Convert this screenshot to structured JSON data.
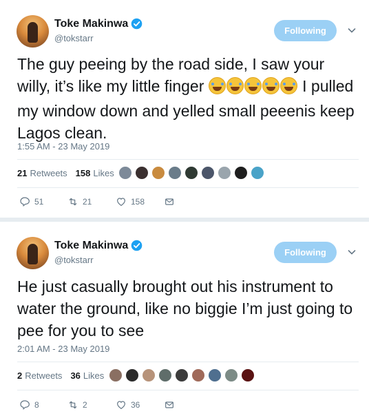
{
  "tweets": [
    {
      "user": {
        "name": "Toke Makinwa",
        "handle": "@tokstarr",
        "verified": true
      },
      "follow_label": "Following",
      "text_before": "The guy peeing by the road side, I saw your willy, it’s like my little finger",
      "emoji": "rolling-on-floor-laughing",
      "emoji_count": 5,
      "text_after": "I pulled my window down and yelled small peeenis keep Lagos clean.",
      "timestamp": "1:55 AM - 23 May 2019",
      "retweets_count": "21",
      "retweets_label": "Retweets",
      "likes_count": "158",
      "likes_label": "Likes",
      "actions": {
        "reply": "51",
        "retweet": "21",
        "like": "158"
      }
    },
    {
      "user": {
        "name": "Toke Makinwa",
        "handle": "@tokstarr",
        "verified": true
      },
      "follow_label": "Following",
      "text": "He just casually brought out his instrument to water the ground, like no biggie I’m just going to pee for you to see",
      "timestamp": "2:01 AM - 23 May 2019",
      "retweets_count": "2",
      "retweets_label": "Retweets",
      "likes_count": "36",
      "likes_label": "Likes",
      "actions": {
        "reply": "8",
        "retweet": "2",
        "like": "36"
      }
    }
  ],
  "colors": {
    "accent": "#1da1f2",
    "follow_bg": "#9bd0f5",
    "muted": "#657786",
    "separator": "#e6ecf0"
  },
  "icons": [
    "verified-badge-icon",
    "chevron-down-icon",
    "reply-icon",
    "retweet-icon",
    "heart-icon",
    "dm-envelope-icon"
  ]
}
